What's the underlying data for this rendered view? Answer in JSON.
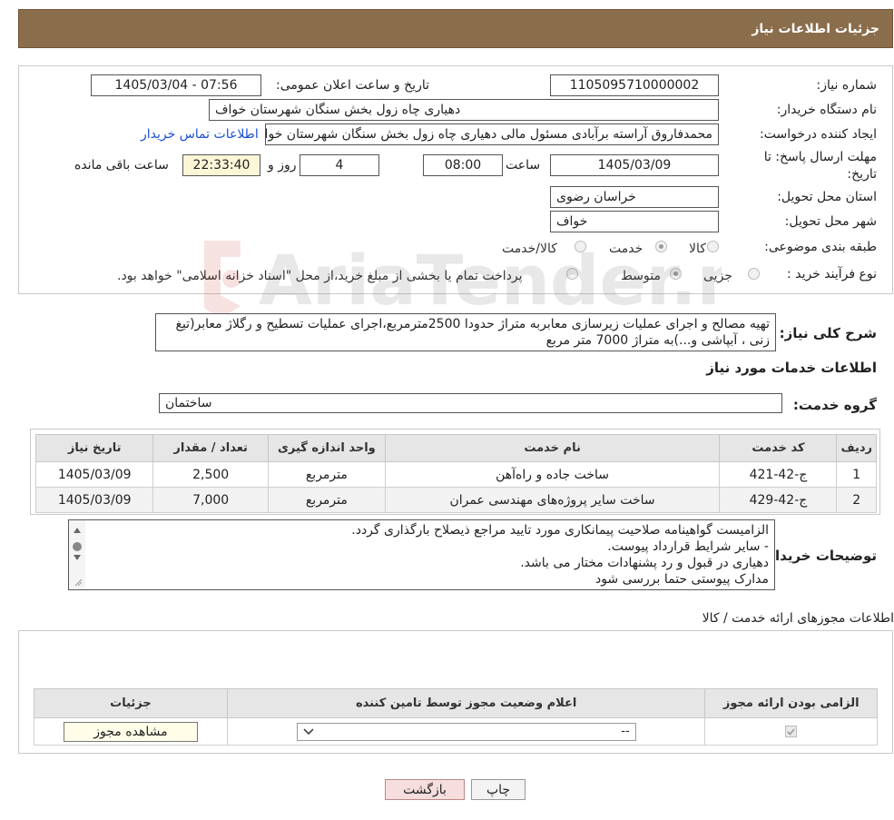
{
  "header": {
    "title": "جزئیات اطلاعات نیاز"
  },
  "form": {
    "need_number_label": "شماره نیاز:",
    "need_number": "1105095710000002",
    "announce_label": "تاریخ و ساعت اعلان عمومی:",
    "announce_value": "1405/03/04 - 07:56",
    "buyer_org_label": "نام دستگاه خریدار:",
    "buyer_org": "دهیاری چاه زول بخش سنگان شهرستان خواف",
    "requester_label": "ایجاد کننده درخواست:",
    "requester": "محمدفاروق آراسته برآبادی مسئول مالی دهیاری چاه زول بخش سنگان شهرستان خواف",
    "contact_link": "اطلاعات تماس خریدار",
    "deadline_label": "مهلت ارسال پاسخ: تا تاریخ:",
    "deadline_date": "1405/03/09",
    "time_label": "ساعت",
    "deadline_time": "08:00",
    "days_value": "4",
    "days_label": "روز و",
    "remaining_time": "22:33:40",
    "remaining_label": "ساعت باقی مانده",
    "province_label": "استان محل تحویل:",
    "province": "خراسان رضوی",
    "city_label": "شهر محل تحویل:",
    "city": "خواف",
    "category_label": "طبقه بندی موضوعی:",
    "category_options": [
      "کالا",
      "خدمت",
      "کالا/خدمت"
    ],
    "category_selected": "خدمت",
    "process_label": "نوع فرآیند خرید :",
    "process_options": [
      "جزیی",
      "متوسط"
    ],
    "process_selected": "متوسط",
    "payment_note": "پرداخت تمام یا بخشی از مبلغ خرید،از محل \"اسناد خزانه اسلامی\" خواهد بود."
  },
  "summary": {
    "label": "شرح کلی نیاز:",
    "text": "تهیه مصالح و اجرای عملیات زیرسازی معابربه متراژ حدودا 2500مترمربع،اجرای عملیات تسطیح و رگلاژ معابر(تیغ زنی ، آبپاشی و...)به متراژ 7000 متر مربع"
  },
  "services": {
    "section_title": "اطلاعات خدمات مورد نیاز",
    "group_label": "گروه خدمت:",
    "group_value": "ساختمان",
    "columns": [
      "ردیف",
      "کد خدمت",
      "نام خدمت",
      "واحد اندازه گیری",
      "تعداد / مقدار",
      "تاریخ نیاز"
    ],
    "rows": [
      {
        "idx": "1",
        "code": "ج-42-421",
        "name": "ساخت جاده و راه‌آهن",
        "unit": "مترمربع",
        "qty": "2,500",
        "date": "1405/03/09"
      },
      {
        "idx": "2",
        "code": "ج-42-429",
        "name": "ساخت سایر پروژه‌های مهندسی عمران",
        "unit": "مترمربع",
        "qty": "7,000",
        "date": "1405/03/09"
      }
    ]
  },
  "buyer_notes": {
    "label": "توضیحات خریدار:",
    "lines": [
      "الزامیست گواهینامه صلاحیت پیمانکاری مورد تایید مراجع ذیصلاح بارگذاری گردد.",
      "- سایر شرایط قرارداد پیوست.",
      "دهیاری در قبول و رد پشنهادات مختار می باشد.",
      "مدارک پیوستی حتما بررسی شود"
    ]
  },
  "permits": {
    "section_title": "اطلاعات مجوزهای ارائه خدمت / کالا",
    "columns": [
      "الزامی بودن ارائه مجوز",
      "اعلام وضعیت مجوز توسط تامین کننده",
      "جزئیات"
    ],
    "select_value": "--",
    "view_button": "مشاهده مجوز"
  },
  "actions": {
    "print": "چاپ",
    "back": "بازگشت"
  },
  "watermark": {
    "text": "AriaTender.neT"
  },
  "colors": {
    "header_bg": "#8a6d4b",
    "link": "#1a4fd6",
    "back_button_bg": "#f6dede"
  }
}
